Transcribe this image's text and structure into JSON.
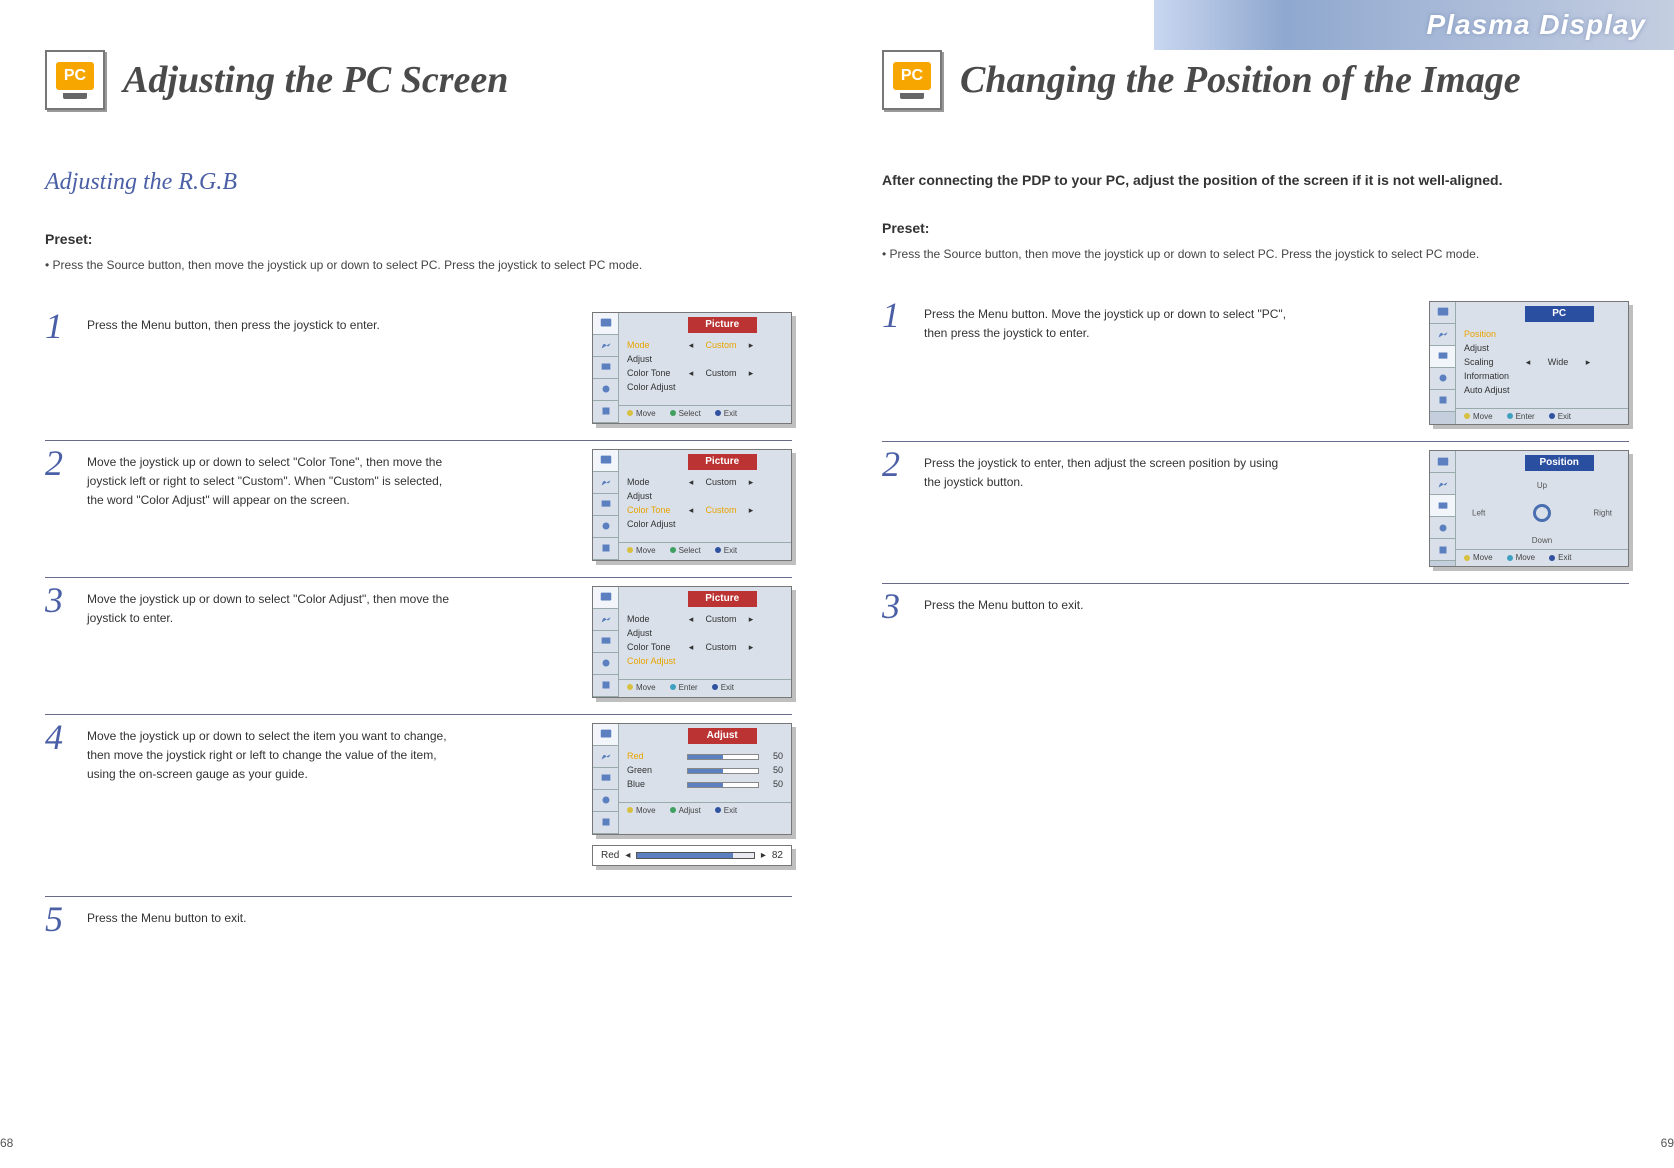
{
  "banner": {
    "text": "Plasma Display"
  },
  "left": {
    "icon_label": "PC",
    "title": "Adjusting the PC Screen",
    "sub": "Adjusting the R.G.B",
    "preset_label": "Preset:",
    "preset_note": "•   Press the Source button, then move the joystick up or down to select PC. Press the joystick to select PC mode.",
    "steps": [
      {
        "n": "1",
        "text": "Press the Menu button, then press the joystick to enter."
      },
      {
        "n": "2",
        "text": "Move the joystick up or down to select \"Color Tone\", then move the joystick left or right to select \"Custom\". When \"Custom\" is selected, the word \"Color Adjust\" will appear on the screen."
      },
      {
        "n": "3",
        "text": "Move the joystick up or down to select \"Color Adjust\", then move the joystick to enter."
      },
      {
        "n": "4",
        "text": "Move the joystick up or down to select the item you want to change, then move the joystick right or left to change the value of the item, using the on-screen gauge as your guide."
      },
      {
        "n": "5",
        "text": "Press the Menu button to exit."
      }
    ],
    "osd": {
      "picture_title": "Picture",
      "adjust_title": "Adjust",
      "rows_picture": {
        "mode": "Mode",
        "adjust": "Adjust",
        "color_tone": "Color Tone",
        "color_adjust": "Color Adjust",
        "custom": "Custom"
      },
      "rows_adjust": {
        "red": "Red",
        "green": "Green",
        "blue": "Blue",
        "val": "50"
      },
      "foot": {
        "move": "Move",
        "select": "Select",
        "enter": "Enter",
        "adjust": "Adjust",
        "exit": "Exit"
      },
      "strip": {
        "label": "Red",
        "value": "82"
      }
    },
    "page_number": "68"
  },
  "right": {
    "icon_label": "PC",
    "title": "Changing the Position of the Image",
    "lead": "After connecting the PDP to your PC, adjust the position of the screen if it is not well-aligned.",
    "preset_label": "Preset:",
    "preset_note": "•   Press the Source button, then move the joystick up or down to select PC. Press the joystick to select PC mode.",
    "steps": [
      {
        "n": "1",
        "text": "Press the Menu button. Move the joystick up or down to select \"PC\", then press the joystick to enter."
      },
      {
        "n": "2",
        "text": "Press the joystick to enter, then adjust the screen position by using the joystick button."
      },
      {
        "n": "3",
        "text": "Press the Menu button to exit."
      }
    ],
    "osd": {
      "pc_title": "PC",
      "position_title": "Position",
      "rows_pc": {
        "position": "Position",
        "adjust": "Adjust",
        "scaling": "Scaling",
        "information": "Information",
        "auto_adjust": "Auto Adjust",
        "wide": "Wide"
      },
      "cross": {
        "up": "Up",
        "down": "Down",
        "left": "Left",
        "right": "Right"
      },
      "foot": {
        "move": "Move",
        "enter": "Enter",
        "exit": "Exit",
        "move2": "Move"
      }
    },
    "page_number": "69"
  }
}
